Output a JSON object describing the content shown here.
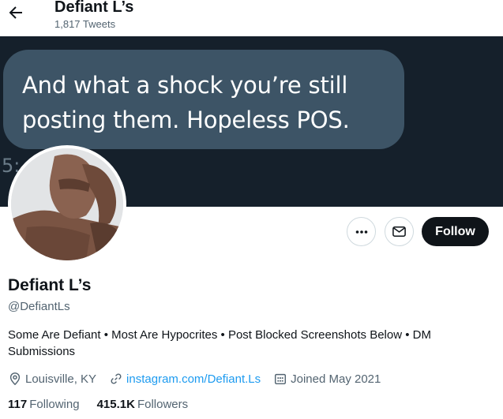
{
  "header": {
    "name": "Defiant L’s",
    "tweet_count": "1,817 Tweets"
  },
  "banner": {
    "quote_text": "And what a shock you’re still posting them. Hopeless POS.",
    "partial_time": "5:"
  },
  "actions": {
    "follow_label": "Follow",
    "more_icon": "more-horizontal-icon",
    "message_icon": "envelope-icon"
  },
  "profile": {
    "display_name": "Defiant L’s",
    "handle": "@DefiantLs",
    "bio": "Some Are Defiant • Most Are Hypocrites • Post Blocked Screenshots Below • DM Submissions",
    "location": "Louisville, KY",
    "website": "instagram.com/Defiant.Ls",
    "joined": "Joined May 2021",
    "following_count": "117",
    "following_label": "Following",
    "followers_count": "415.1K",
    "followers_label": "Followers"
  },
  "colors": {
    "banner_bg": "#15202b",
    "bubble_bg": "#3d5466",
    "link": "#1d9bf0",
    "secondary_text": "#536471",
    "primary_text": "#0f1419"
  }
}
